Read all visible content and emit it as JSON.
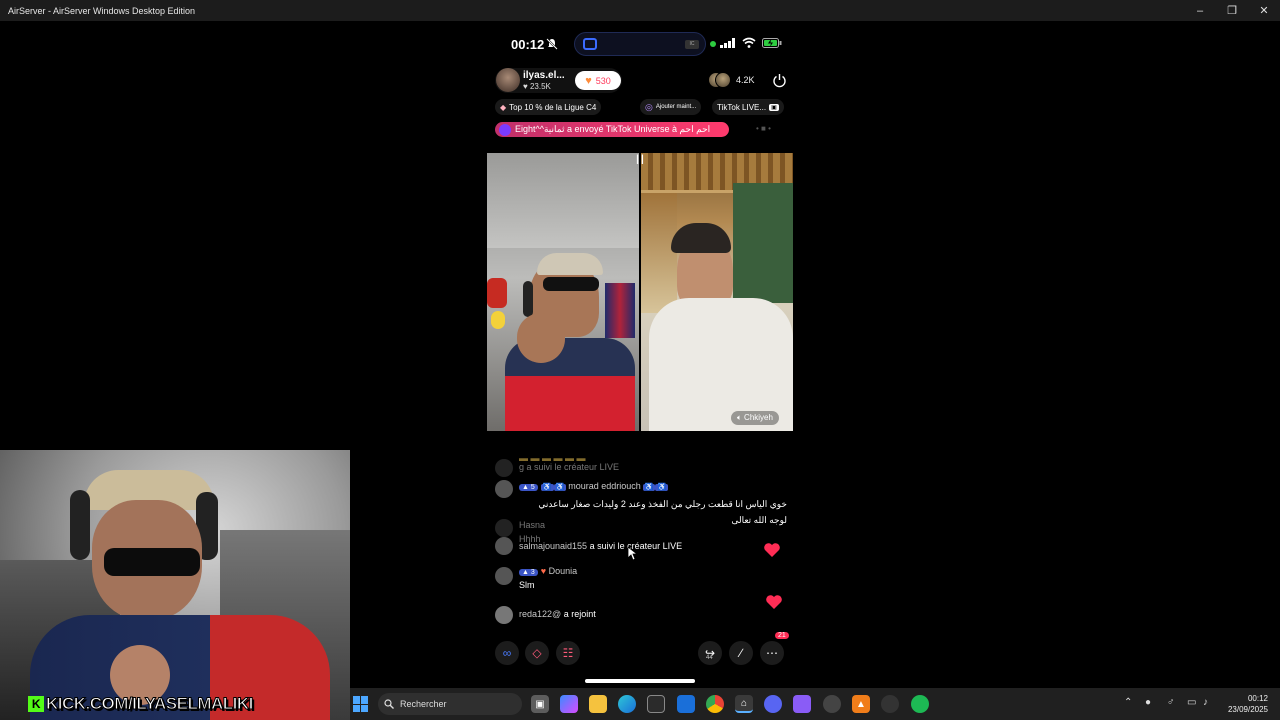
{
  "window": {
    "title": "AirServer - AirServer Windows Desktop Edition",
    "controls": [
      "minimize",
      "maximize",
      "close"
    ]
  },
  "phone_status": {
    "time": "00:12",
    "island_badge": "IC"
  },
  "live_header": {
    "host_name": "ilyas.el...",
    "host_likes": "23.5K",
    "heart_count": "530",
    "viewer_count": "4.2K",
    "chip_rank": "Top 10 % de la Ligue C4",
    "chip_add": "Ajouter maint...",
    "chip_live": "TikTok LIVE...",
    "gift_banner": "Eight^^ثمانية a envoyé TikTok Universe à احم احم"
  },
  "video": {
    "speaker_label": "Chkiyeh"
  },
  "chat": [
    {
      "level": "",
      "user": "",
      "text": "a suivi le créateur LIVE",
      "faded": true
    },
    {
      "level": "5",
      "user": "mourad eddriouch",
      "text": "خوي الياس انا قطعت رجلي من الفخذ وعند 2 وليدات صغار ساعدني لوجه الله تعالى",
      "faded": false
    },
    {
      "level": "",
      "user": "Hasna",
      "text": "Hhhh",
      "faded": true
    },
    {
      "level": "",
      "user": "salmajounaid155",
      "text": "a suivi le créateur LIVE",
      "faded": false
    },
    {
      "level": "3",
      "user": "Dounia",
      "text": "Slm",
      "faded": false
    },
    {
      "level": "",
      "user": "reda122@",
      "text": "a rejoint",
      "faded": false
    }
  ],
  "bottom_bar": {
    "likes_badge": "21",
    "share_count": "44"
  },
  "overlay": {
    "kick_url": "KICK.COM/ILYASELMALIKI"
  },
  "taskbar": {
    "search_placeholder": "Rechercher",
    "clock_time": "00:12",
    "clock_date": "23/09/2025"
  },
  "colors": {
    "accent_pink": "#ff3b5c",
    "kick_green": "#53fc18",
    "taskbar": "#202020"
  }
}
